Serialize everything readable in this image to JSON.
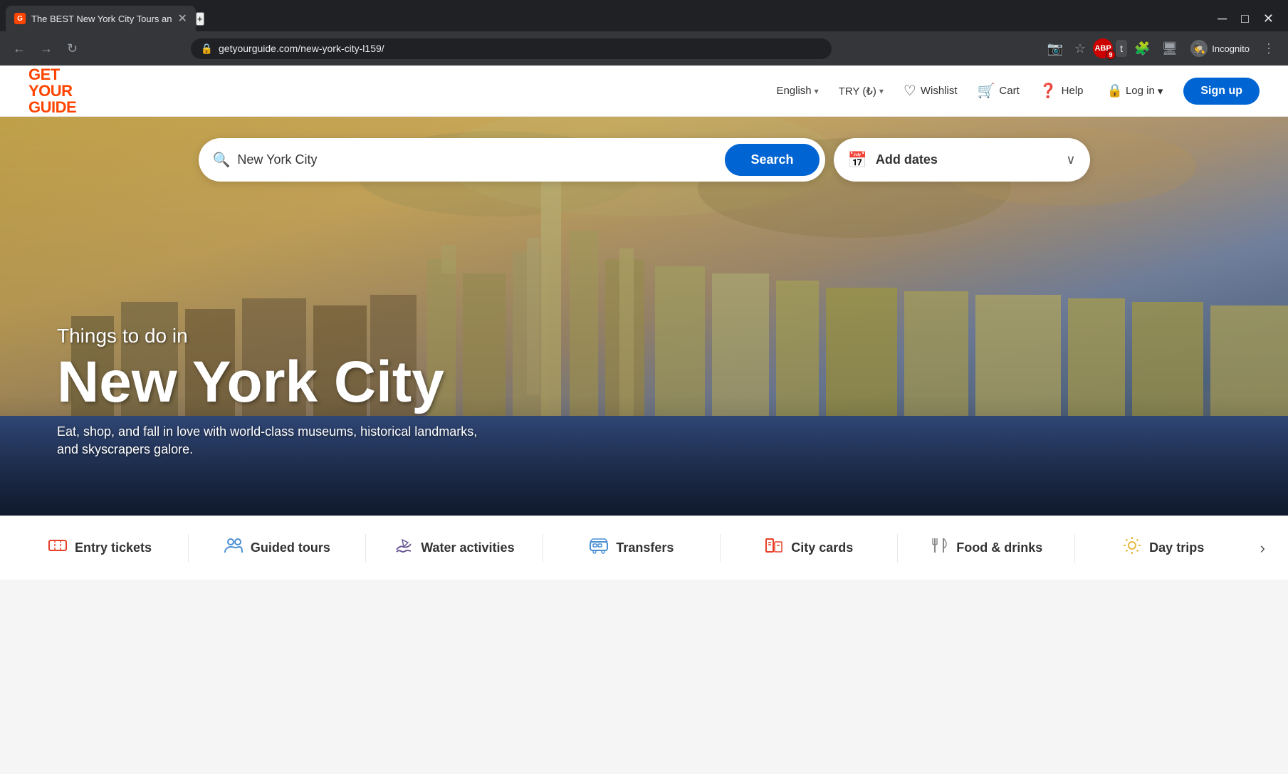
{
  "browser": {
    "tab_title": "The BEST New York City Tours an",
    "tab_favicon": "G",
    "new_tab_label": "+",
    "url": "getyourguide.com/new-york-city-l159/",
    "window_controls": {
      "minimize": "─",
      "maximize": "□",
      "close": "✕",
      "chevron_down": "⌄"
    },
    "toolbar": {
      "incognito_label": "Incognito",
      "extensions_icon": "⚙",
      "abp_count": "9",
      "reader_icon": "📖",
      "bookmark_icon": "☆",
      "profile_icon": "👤",
      "puzzle_icon": "🧩",
      "cast_icon": "📺",
      "menu_icon": "⋮"
    }
  },
  "site": {
    "logo": {
      "get": "GET",
      "your": "YOUR",
      "guide": "GUIDE"
    },
    "nav": {
      "language_label": "English",
      "currency_label": "TRY (₺)",
      "wishlist_label": "Wishlist",
      "cart_label": "Cart",
      "help_label": "Help",
      "login_label": "Log in",
      "signup_label": "Sign up"
    },
    "hero": {
      "subtitle": "Things to do in",
      "title": "New York City",
      "description": "Eat, shop, and fall in love with world-class museums, historical landmarks, and skyscrapers galore.",
      "search_value": "New York City",
      "search_placeholder": "New York City",
      "search_button": "Search",
      "date_placeholder": "Add dates"
    },
    "categories": [
      {
        "id": "entry-tickets",
        "label": "Entry tickets",
        "icon": "🎟",
        "color": "#e8402a"
      },
      {
        "id": "guided-tours",
        "label": "Guided tours",
        "icon": "👥",
        "color": "#4a8fd4"
      },
      {
        "id": "water-activities",
        "label": "Water activities",
        "icon": "⛵",
        "color": "#6b5b95"
      },
      {
        "id": "transfers",
        "label": "Transfers",
        "icon": "🚌",
        "color": "#4a8fd4"
      },
      {
        "id": "city-cards",
        "label": "City cards",
        "icon": "🏢",
        "color": "#e8402a"
      },
      {
        "id": "food-drinks",
        "label": "Food & drinks",
        "icon": "🍴",
        "color": "#888"
      },
      {
        "id": "day-trips",
        "label": "Day trips",
        "icon": "✨",
        "color": "#e8b840"
      }
    ],
    "category_next_icon": "›"
  }
}
